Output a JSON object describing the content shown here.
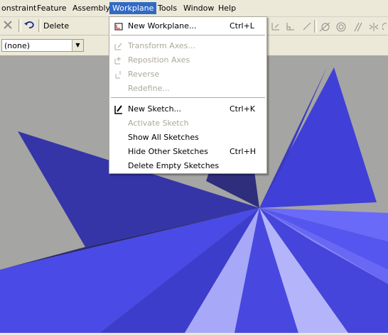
{
  "menubar": {
    "items": [
      "onstraint",
      "Feature",
      "Assembly",
      "Workplane",
      "Tools",
      "Window",
      "Help"
    ]
  },
  "toolbar": {
    "delete_label": "Delete"
  },
  "toolbar2": {
    "combo_value": "(none)"
  },
  "workplane_menu": {
    "items": [
      {
        "label": "New Workplane...",
        "shortcut": "Ctrl+L",
        "enabled": true,
        "icon": "new-workplane-icon"
      },
      {
        "label": "Transform Axes...",
        "shortcut": "",
        "enabled": false,
        "icon": "transform-axes-icon"
      },
      {
        "label": "Reposition Axes",
        "shortcut": "",
        "enabled": false,
        "icon": "reposition-axes-icon"
      },
      {
        "label": "Reverse",
        "shortcut": "",
        "enabled": false,
        "icon": "reverse-icon"
      },
      {
        "label": "Redefine...",
        "shortcut": "",
        "enabled": false,
        "icon": ""
      },
      {
        "label": "New Sketch...",
        "shortcut": "Ctrl+K",
        "enabled": true,
        "icon": "new-sketch-icon"
      },
      {
        "label": "Activate Sketch",
        "shortcut": "",
        "enabled": false,
        "icon": ""
      },
      {
        "label": "Show All Sketches",
        "shortcut": "",
        "enabled": true,
        "icon": ""
      },
      {
        "label": "Hide Other Sketches",
        "shortcut": "Ctrl+H",
        "enabled": true,
        "icon": ""
      },
      {
        "label": "Delete Empty Sketches",
        "shortcut": "",
        "enabled": true,
        "icon": ""
      }
    ]
  },
  "colors": {
    "menu_highlight": "#316ac5",
    "viewport_bg": "#a5a5a3",
    "shape_dark": "#2e2e7c",
    "shape_mid": "#3d3dcc",
    "shape_light": "#a8a8f8"
  }
}
